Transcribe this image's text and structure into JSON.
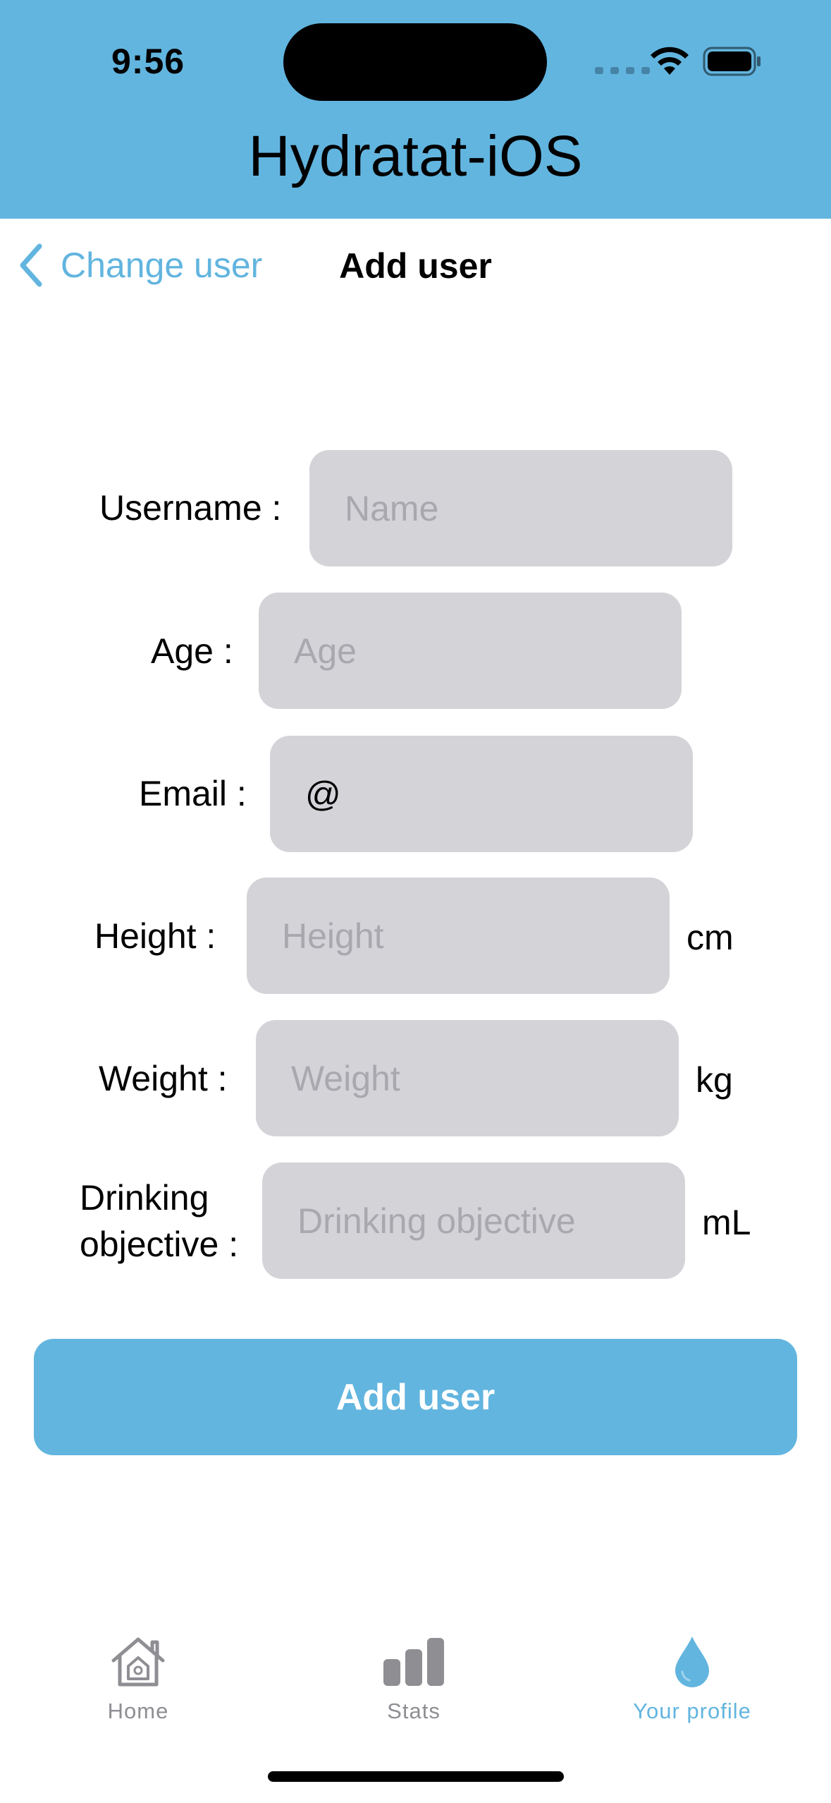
{
  "status_bar": {
    "time": "9:56"
  },
  "app": {
    "title": "Hydratat-iOS"
  },
  "nav": {
    "back_label": "Change user",
    "title": "Add user"
  },
  "form": {
    "username": {
      "label": "Username :",
      "placeholder": "Name",
      "value": ""
    },
    "age": {
      "label": "Age :",
      "placeholder": "Age",
      "value": ""
    },
    "email": {
      "label": "Email :",
      "placeholder": "",
      "value": "@"
    },
    "height": {
      "label": "Height :",
      "placeholder": "Height",
      "value": "",
      "unit": "cm"
    },
    "weight": {
      "label": "Weight :",
      "placeholder": "Weight",
      "value": "",
      "unit": "kg"
    },
    "objective": {
      "label_line1": "Drinking",
      "label_line2": "objective :",
      "placeholder": "Drinking objective",
      "value": "",
      "unit": "mL"
    },
    "submit_label": "Add user"
  },
  "tabs": [
    {
      "label": "Home",
      "icon": "house-icon",
      "active": false
    },
    {
      "label": "Stats",
      "icon": "bar-chart-icon",
      "active": false
    },
    {
      "label": "Your profile",
      "icon": "drop-icon",
      "active": true
    }
  ],
  "colors": {
    "accent": "#62b5df",
    "field_bg": "#d3d3d8",
    "inactive_tab": "#8e8e93"
  }
}
